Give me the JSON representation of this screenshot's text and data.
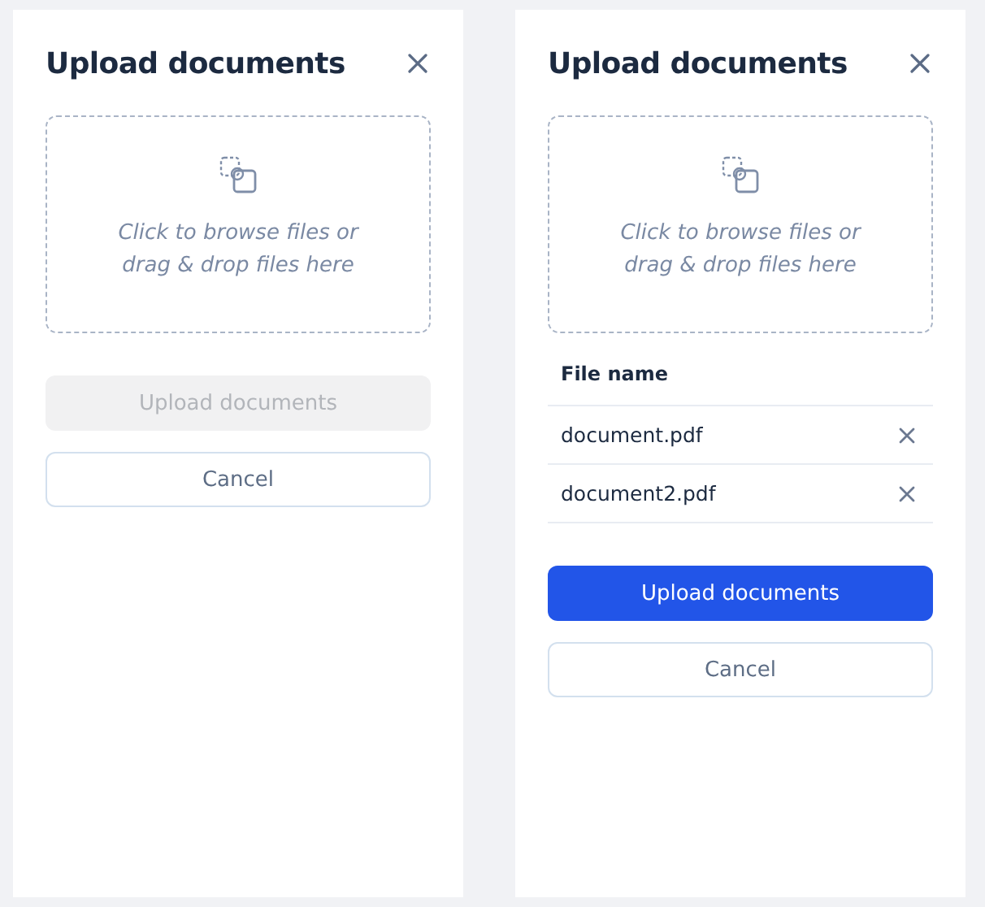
{
  "panels": [
    {
      "title": "Upload documents",
      "dropzone": {
        "text": "Click to browse files or drag & drop files here"
      },
      "upload_button": {
        "label": "Upload documents",
        "disabled": true
      },
      "cancel_button": {
        "label": "Cancel"
      }
    },
    {
      "title": "Upload documents",
      "dropzone": {
        "text": "Click to browse files or drag & drop files here"
      },
      "file_table": {
        "header": "File name",
        "files": [
          "document.pdf",
          "document2.pdf"
        ]
      },
      "upload_button": {
        "label": "Upload documents",
        "disabled": false
      },
      "cancel_button": {
        "label": "Cancel"
      }
    }
  ]
}
